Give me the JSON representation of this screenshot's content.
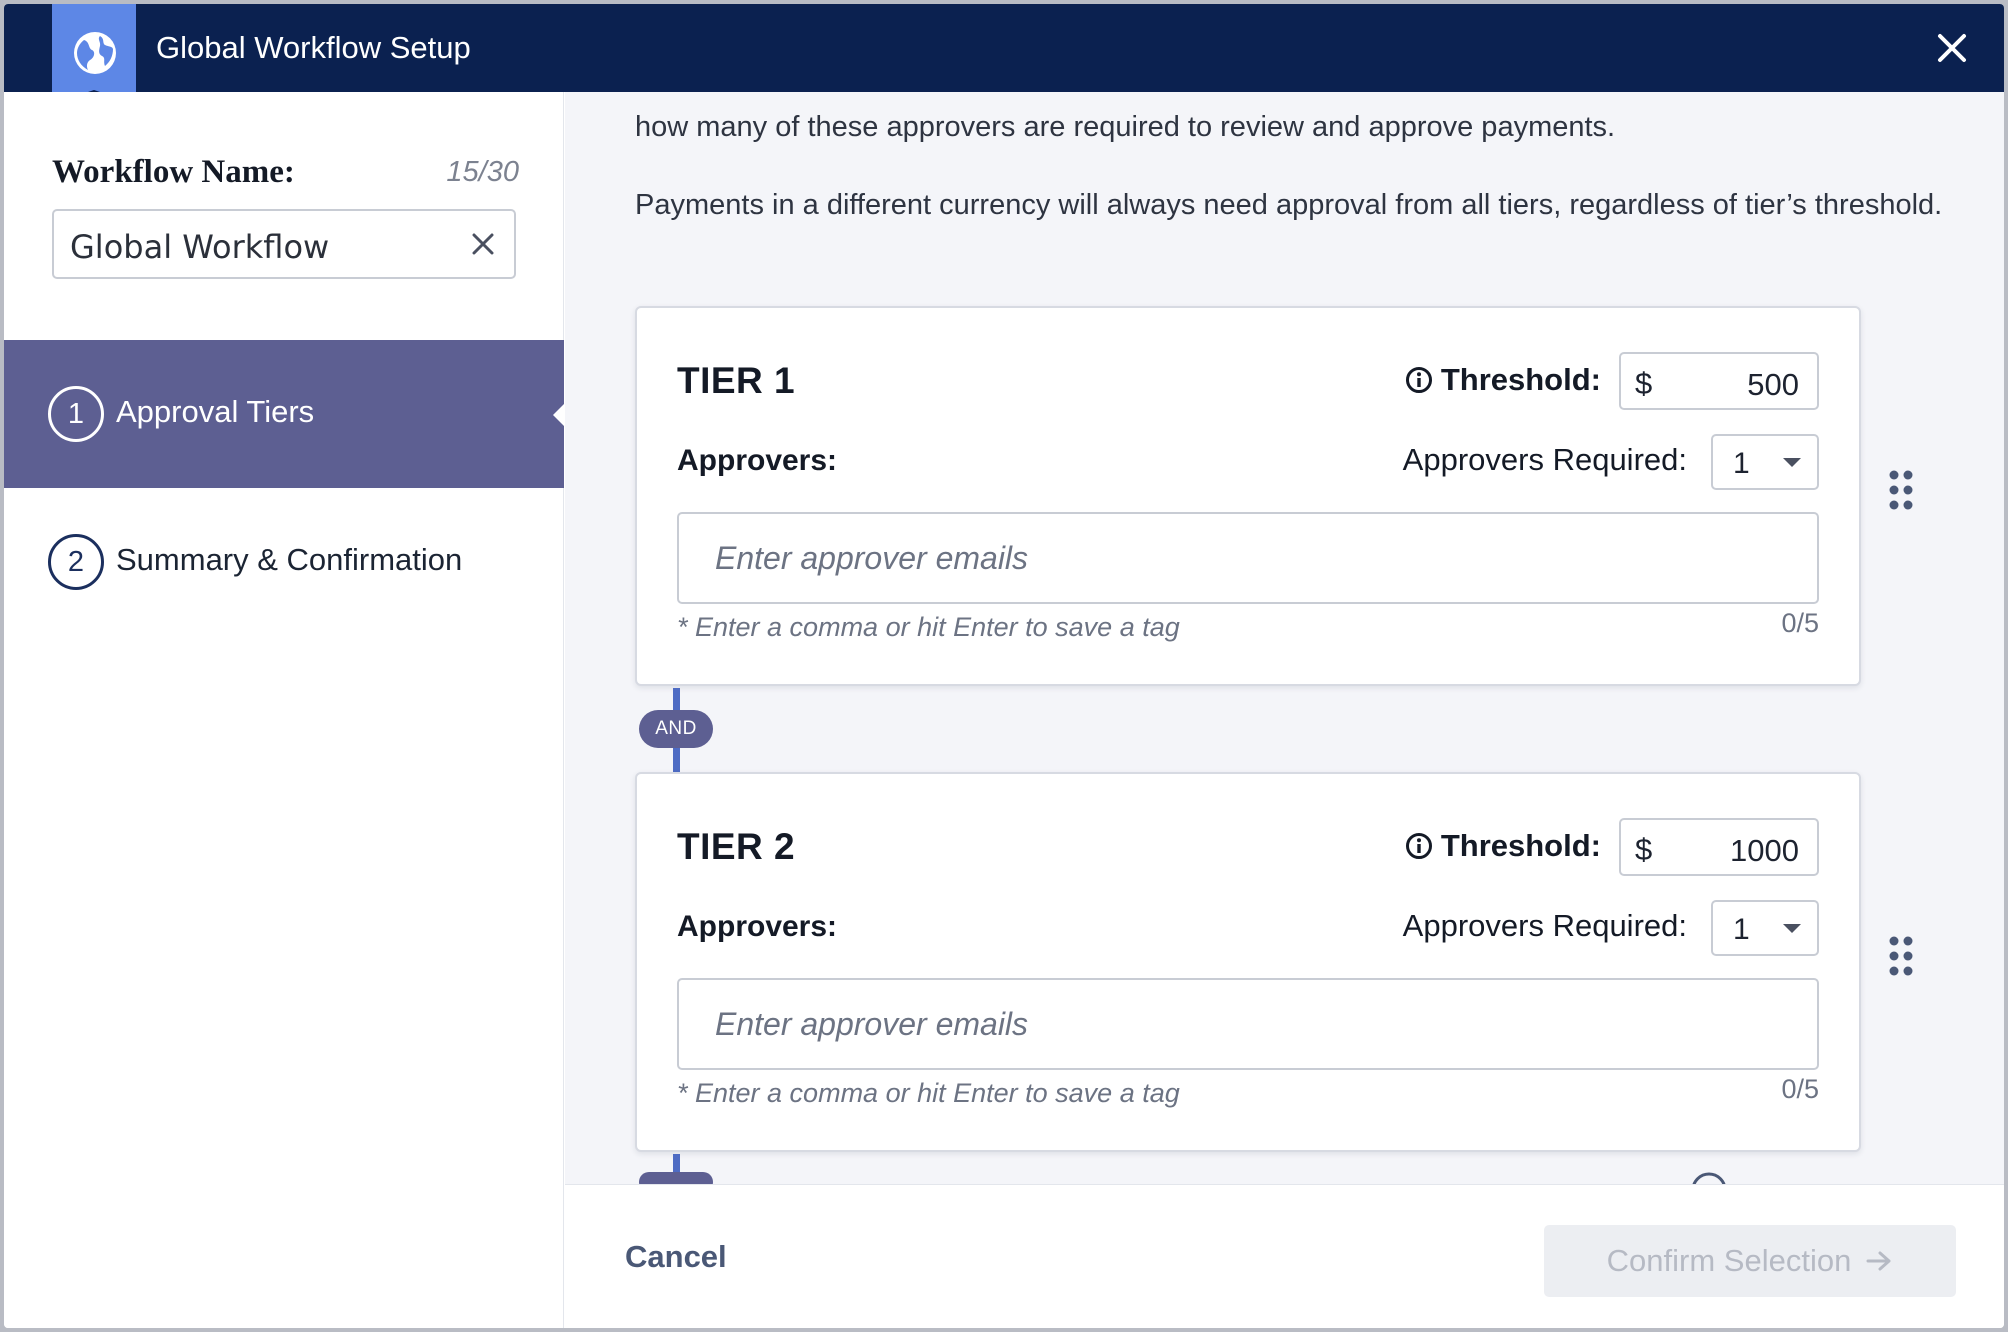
{
  "header": {
    "title": "Global Workflow Setup",
    "badge_icon": "globe-icon",
    "close_icon": "close-icon"
  },
  "sidebar": {
    "workflow_name_label": "Workflow Name:",
    "workflow_name_count": "15/30",
    "workflow_name_value": "Global Workflow",
    "steps": [
      {
        "number": "1",
        "label": "Approval Tiers",
        "active": true
      },
      {
        "number": "2",
        "label": "Summary & Confirmation",
        "active": false
      }
    ]
  },
  "intro": {
    "line_clipped": "how many of these approvers are required to review and approve payments.",
    "currency_note": "Payments in a different currency will always need approval from all tiers, regardless of tier’s threshold."
  },
  "tiers": [
    {
      "title": "TIER 1",
      "threshold_label": "Threshold:",
      "currency": "$",
      "threshold": "500",
      "approvers_label": "Approvers:",
      "required_label": "Approvers Required:",
      "required_value": "1",
      "email_placeholder": "Enter approver emails",
      "hint": "* Enter a comma or hit Enter to save a tag",
      "tag_count": "0/5"
    },
    {
      "title": "TIER 2",
      "threshold_label": "Threshold:",
      "currency": "$",
      "threshold": "1000",
      "approvers_label": "Approvers:",
      "required_label": "Approvers Required:",
      "required_value": "1",
      "email_placeholder": "Enter approver emails",
      "hint": "* Enter a comma or hit Enter to save a tag",
      "tag_count": "0/5"
    }
  ],
  "connector": {
    "label": "AND"
  },
  "footer": {
    "cancel_label": "Cancel",
    "confirm_label": "Confirm Selection",
    "confirm_icon": "arrow-right-icon"
  },
  "colors": {
    "header_bg": "#0b2150",
    "badge_bg": "#5d87e6",
    "active_step_bg": "#5d5f92",
    "connector": "#4e6cc4",
    "main_bg": "#f4f5f9"
  }
}
